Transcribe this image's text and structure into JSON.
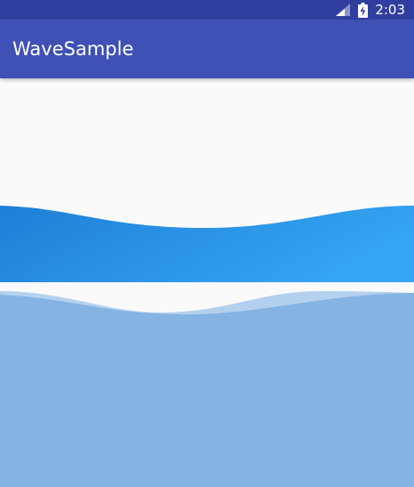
{
  "status_bar": {
    "time": "2:03",
    "signal_icon": "cell-signal-icon",
    "battery_icon": "battery-charging-icon"
  },
  "app_bar": {
    "title": "WaveSample"
  },
  "waves": [
    {
      "name": "gradient-wave",
      "colors": {
        "start": "#1e7fd6",
        "end": "#35a4f2"
      }
    },
    {
      "name": "translucent-wave",
      "colors": {
        "back": "#b3d1ee",
        "front": "#85b3e2"
      }
    }
  ]
}
